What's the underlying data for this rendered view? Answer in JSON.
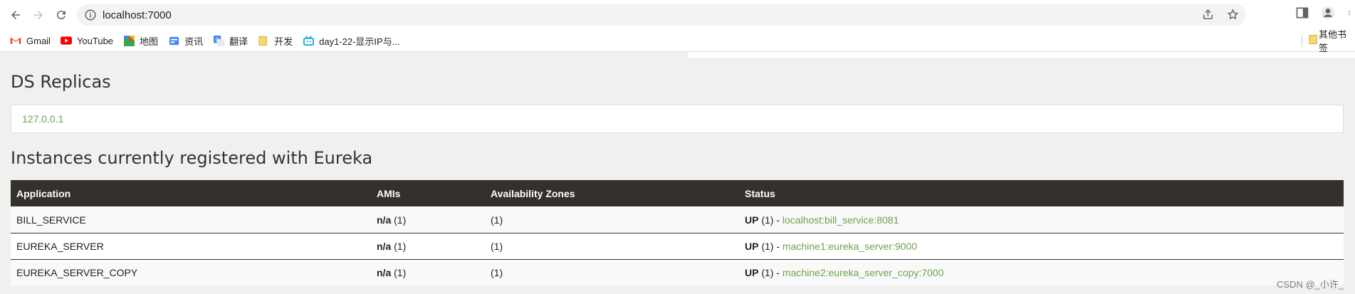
{
  "browser": {
    "url": "localhost:7000",
    "bookmarks": [
      {
        "label": "Gmail",
        "icon": "gmail-icon"
      },
      {
        "label": "YouTube",
        "icon": "youtube-icon"
      },
      {
        "label": "地图",
        "icon": "maps-icon"
      },
      {
        "label": "资讯",
        "icon": "news-icon"
      },
      {
        "label": "翻译",
        "icon": "translate-icon"
      },
      {
        "label": "开发",
        "icon": "folder-icon"
      },
      {
        "label": "day1-22-显示IP与...",
        "icon": "bilibili-icon"
      }
    ],
    "other_bookmarks": "其他书签"
  },
  "replicas": {
    "title": "DS Replicas",
    "items": [
      "127.0.0.1"
    ]
  },
  "instances": {
    "title": "Instances currently registered with Eureka",
    "headers": [
      "Application",
      "AMIs",
      "Availability Zones",
      "Status"
    ],
    "rows": [
      {
        "application": "BILL_SERVICE",
        "ami": "n/a",
        "ami_count": " (1)",
        "zones": "(1)",
        "status": "UP",
        "status_count": " (1) - ",
        "instance": "localhost:bill_service:8081"
      },
      {
        "application": "EUREKA_SERVER",
        "ami": "n/a",
        "ami_count": " (1)",
        "zones": "(1)",
        "status": "UP",
        "status_count": " (1) - ",
        "instance": "machine1:eureka_server:9000"
      },
      {
        "application": "EUREKA_SERVER_COPY",
        "ami": "n/a",
        "ami_count": " (1)",
        "zones": "(1)",
        "status": "UP",
        "status_count": " (1) - ",
        "instance": "machine2:eureka_server_copy:7000"
      }
    ]
  },
  "watermark": "CSDN @_小许_",
  "colors": {
    "link": "#6da34d",
    "header_bg": "#34302d",
    "page_bg": "#f0f0ef"
  }
}
